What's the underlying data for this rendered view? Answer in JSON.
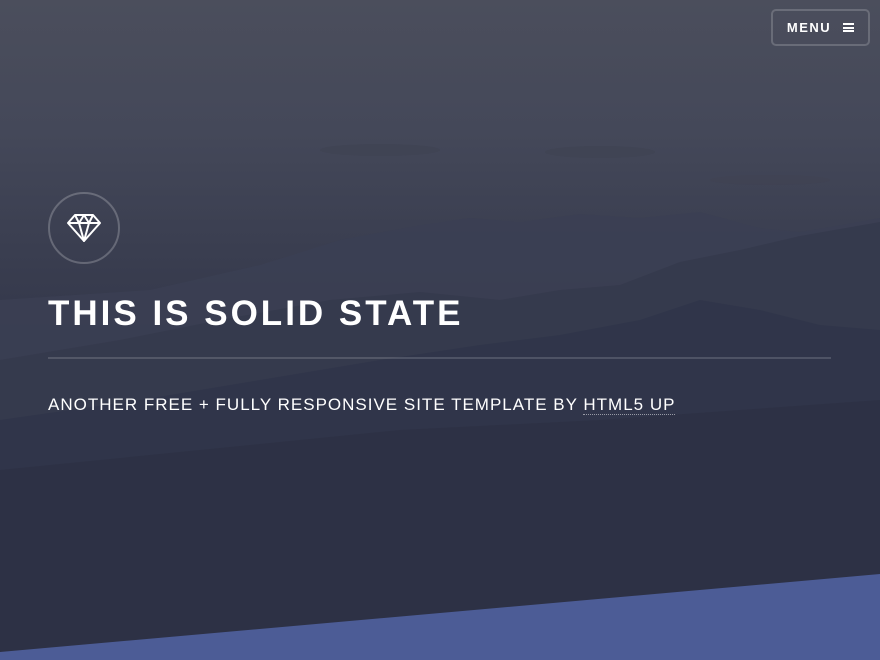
{
  "menu": {
    "label": "MENU",
    "icon": "hamburger-icon"
  },
  "logo": {
    "icon": "diamond-icon"
  },
  "hero": {
    "title": "THIS IS SOLID STATE",
    "subtitle_text": "ANOTHER FREE + FULLY RESPONSIVE SITE TEMPLATE BY ",
    "subtitle_link": "HTML5 UP"
  },
  "colors": {
    "background": "#2e3141",
    "accent": "#4c5c96",
    "text": "#ffffff"
  }
}
